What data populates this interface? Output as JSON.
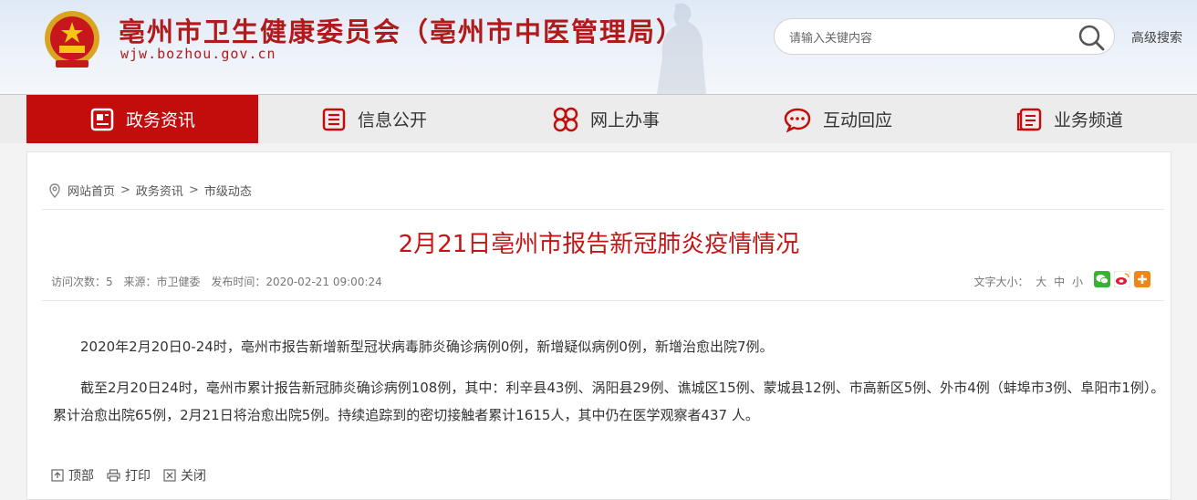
{
  "header": {
    "site_title": "亳州市卫生健康委员会（亳州市中医管理局）",
    "site_url": "wjw.bozhou.gov.cn",
    "search_placeholder": "请输入关键内容",
    "advanced_search": "高级搜索"
  },
  "nav": {
    "items": [
      {
        "label": "政务资讯",
        "icon": "news-icon",
        "active": true
      },
      {
        "label": "信息公开",
        "icon": "list-icon",
        "active": false
      },
      {
        "label": "网上办事",
        "icon": "clover-icon",
        "active": false
      },
      {
        "label": "互动回应",
        "icon": "chat-icon",
        "active": false
      },
      {
        "label": "业务频道",
        "icon": "document-icon",
        "active": false
      }
    ]
  },
  "breadcrumb": {
    "icon": "location-pin-icon",
    "items": [
      "网站首页",
      "政务资讯",
      "市级动态"
    ],
    "separator": ">"
  },
  "article": {
    "title": "2月21日亳州市报告新冠肺炎疫情情况",
    "meta": {
      "visits": "访问次数：5",
      "source": "来源：市卫健委",
      "published": "发布时间：2020-02-21 09:00:24"
    },
    "font_size": {
      "label": "文字大小：",
      "options": [
        "大",
        "中",
        "小"
      ]
    },
    "share_icons": [
      "wechat-icon",
      "weibo-icon",
      "plus-share-icon"
    ],
    "paragraphs": [
      "2020年2月20日0-24时，亳州市报告新增新型冠状病毒肺炎确诊病例0例，新增疑似病例0例，新增治愈出院7例。",
      "截至2月20日24时，亳州市累计报告新冠肺炎确诊病例108例，其中：利辛县43例、涡阳县29例、谯城区15例、蒙城县12例、市高新区5例、外市4例（蚌埠市3例、阜阳市1例）。累计治愈出院65例，2月21日将治愈出院5例。持续追踪到的密切接触者累计1615人，其中仍在医学观察者437 人。"
    ]
  },
  "tools": {
    "top": "顶部",
    "print": "打印",
    "close": "关闭"
  },
  "colors": {
    "brand_red": "#c30d0d",
    "title_red": "#c31515"
  }
}
